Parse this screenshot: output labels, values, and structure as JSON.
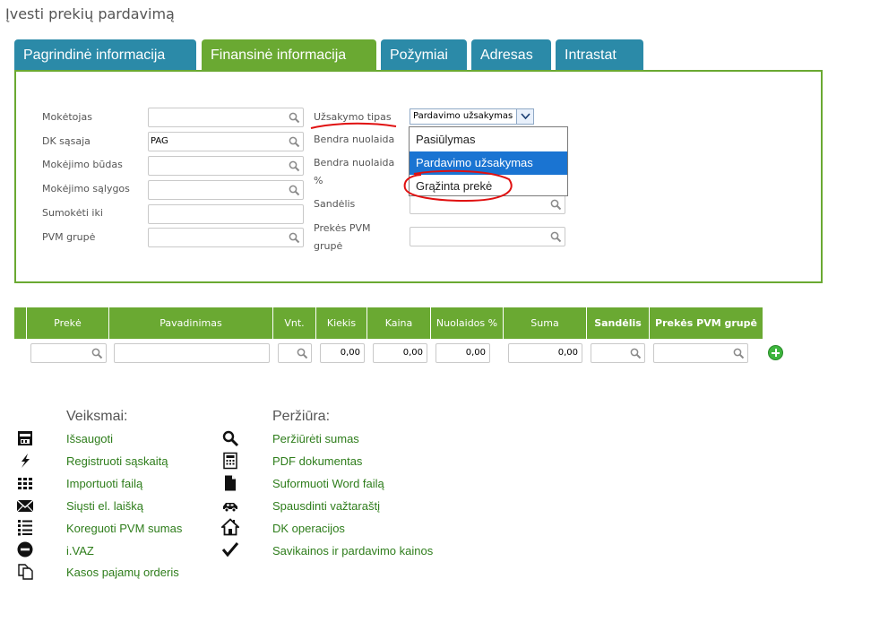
{
  "page": {
    "title": "Įvesti prekių pardavimą"
  },
  "tabs": [
    {
      "label": "Pagrindinė informacija",
      "active": false
    },
    {
      "label": "Finansinė informacija",
      "active": true
    },
    {
      "label": "Požymiai",
      "active": false
    },
    {
      "label": "Adresas",
      "active": false
    },
    {
      "label": "Intrastat",
      "active": false
    }
  ],
  "form": {
    "left": {
      "payer_label": "Mokėtojas",
      "dk_label": "DK sąsaja",
      "dk_value": "PAG",
      "payment_method_label": "Mokėjimo būdas",
      "payment_terms_label": "Mokėjimo sąlygos",
      "pay_until_label": "Sumokėti iki",
      "vat_group_label": "PVM grupė"
    },
    "right": {
      "order_type_label": "Užsakymo tipas",
      "order_type_value": "Pardavimo užsakymas",
      "total_discount_label": "Bendra nuolaida",
      "total_discount_pct_label_1": "Bendra nuolaida",
      "total_discount_pct_label_2": "%",
      "warehouse_label": "Sandėlis",
      "item_vat_group_label_1": "Prekės PVM",
      "item_vat_group_label_2": "grupė"
    },
    "order_type_options": [
      "Pasiūlymas",
      "Pardavimo užsakymas",
      "Grąžinta prekė"
    ],
    "order_type_selected_index": 1
  },
  "grid": {
    "headers": [
      "Prekė",
      "Pavadinimas",
      "Vnt.",
      "Kiekis",
      "Kaina",
      "Nuolaidos %",
      "Suma",
      "Sandėlis",
      "Prekės PVM grupė"
    ],
    "row": {
      "kiekis": "0,00",
      "kaina": "0,00",
      "nuolaidos": "0,00",
      "suma": "0,00"
    }
  },
  "actions": {
    "title": "Veiksmai:",
    "items": [
      "Išsaugoti",
      "Registruoti sąskaitą",
      "Importuoti failą",
      "Siųsti el. laišką",
      "Koreguoti PVM sumas",
      "i.VAZ",
      "Kasos pajamų orderis"
    ]
  },
  "preview": {
    "title": "Peržiūra:",
    "items": [
      "Peržiūrėti sumas",
      "PDF dokumentas",
      "Suformuoti Word failą",
      "Spausdinti važtaraštį",
      "DK operacijos",
      "Savikainos ir pardavimo kainos"
    ]
  },
  "colors": {
    "tab_blue": "#2b8aa8",
    "green": "#6aa932",
    "link_green": "#2e7d1b",
    "dropdown_highlight": "#1a74d2",
    "annotation_red": "#e01010"
  }
}
